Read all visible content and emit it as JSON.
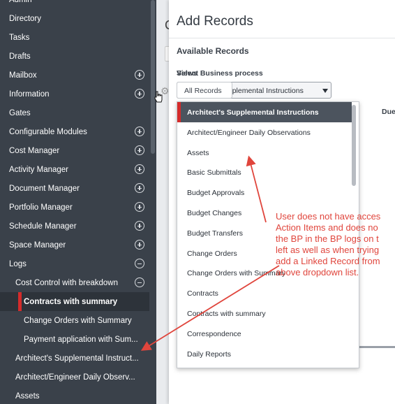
{
  "sidebar": {
    "items": [
      {
        "label": "Admin",
        "level": 0,
        "toggle": "none"
      },
      {
        "label": "Directory",
        "level": 0,
        "toggle": "none"
      },
      {
        "label": "Tasks",
        "level": 0,
        "toggle": "none"
      },
      {
        "label": "Drafts",
        "level": 0,
        "toggle": "none"
      },
      {
        "label": "Mailbox",
        "level": 0,
        "toggle": "expand"
      },
      {
        "label": "Information",
        "level": 0,
        "toggle": "expand"
      },
      {
        "label": "Gates",
        "level": 0,
        "toggle": "none"
      },
      {
        "label": "Configurable Modules",
        "level": 0,
        "toggle": "expand"
      },
      {
        "label": "Cost Manager",
        "level": 0,
        "toggle": "expand"
      },
      {
        "label": "Activity Manager",
        "level": 0,
        "toggle": "expand"
      },
      {
        "label": "Document Manager",
        "level": 0,
        "toggle": "expand"
      },
      {
        "label": "Portfolio Manager",
        "level": 0,
        "toggle": "expand"
      },
      {
        "label": "Schedule Manager",
        "level": 0,
        "toggle": "expand"
      },
      {
        "label": "Space Manager",
        "level": 0,
        "toggle": "expand"
      },
      {
        "label": "Logs",
        "level": 0,
        "toggle": "collapse"
      },
      {
        "label": "Cost Control with breakdown",
        "level": 1,
        "toggle": "collapse"
      },
      {
        "label": "Contracts with summary",
        "level": 2,
        "toggle": "none",
        "active": true
      },
      {
        "label": "Change Orders with Summary",
        "level": 2,
        "toggle": "none"
      },
      {
        "label": "Payment application with Sum...",
        "level": 2,
        "toggle": "none"
      },
      {
        "label": "Architect's Supplemental Instruct...",
        "level": 1,
        "toggle": "none"
      },
      {
        "label": "Architect/Engineer Daily Observ...",
        "level": 1,
        "toggle": "none"
      },
      {
        "label": "Assets",
        "level": 1,
        "toggle": "none"
      }
    ]
  },
  "background": {
    "partial_heading": "C",
    "gear_icon": "gear-icon"
  },
  "panel": {
    "title": "Add Records",
    "available_records": "Available Records",
    "select_bp_label": "Select Business process",
    "bp_selected": "Architect's Supplemental Instructions",
    "views_label": "Views",
    "views_value": "All Records",
    "column_due": "Due"
  },
  "dropdown": {
    "options": [
      {
        "label": "Architect's Supplemental Instructions",
        "selected": true
      },
      {
        "label": "Architect/Engineer Daily Observations"
      },
      {
        "label": "Assets"
      },
      {
        "label": "Basic Submittals"
      },
      {
        "label": "Budget Approvals"
      },
      {
        "label": "Budget Changes"
      },
      {
        "label": "Budget Transfers"
      },
      {
        "label": "Change Orders"
      },
      {
        "label": "Change Orders with Summary"
      },
      {
        "label": "Contracts"
      },
      {
        "label": "Contracts with summary"
      },
      {
        "label": "Correspondence"
      },
      {
        "label": "Daily Reports"
      }
    ]
  },
  "annotation": {
    "text": "User does not have acces\nAction Items and does no\nthe BP in the BP logs on t\nleft as well as when trying\nadd a Linked Record from\nabove dropdown list.",
    "color": "#e0453c"
  },
  "colors": {
    "sidebar_bg": "#3a414a",
    "active_marker": "#d42b2b",
    "dropdown_selected_bg": "#4c545e"
  }
}
